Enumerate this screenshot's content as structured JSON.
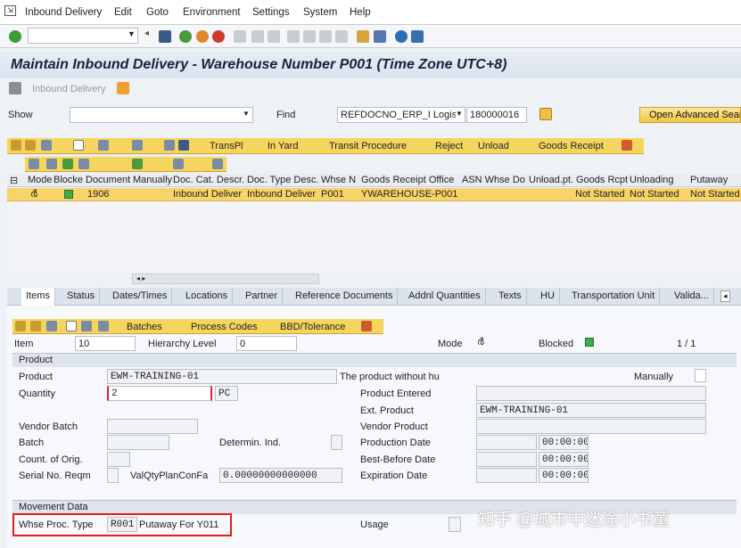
{
  "menu": {
    "items": [
      "Inbound Delivery",
      "Edit",
      "Goto",
      "Environment",
      "Settings",
      "System",
      "Help"
    ]
  },
  "title": "Maintain Inbound Delivery - Warehouse Number P001 (Time Zone UTC+8)",
  "app_toolbar": {
    "inbound_delivery": "Inbound Delivery"
  },
  "search": {
    "show_label": "Show",
    "find_label": "Find",
    "find_select": "REFDOCNO_ERP_I Logist",
    "find_value": "180000016",
    "open_advanced": "Open Advanced Sear"
  },
  "doc_toolbar": {
    "transpl": "TransPl",
    "in_yard": "In Yard",
    "transit": "Transit Procedure",
    "reject": "Reject",
    "unload": "Unload",
    "goods_receipt": "Goods Receipt"
  },
  "table": {
    "headers": [
      "Mode",
      "Blocke",
      "Document",
      "Manually",
      "Doc. Cat. Descr.",
      "Doc. Type Desc.",
      "Whse N",
      "Goods Receipt Office",
      "ASN Whse Do",
      "Unload.pt.",
      "Goods Rcpt",
      "Unloading",
      "Putaway"
    ],
    "row": {
      "document": "1906",
      "doc_cat": "Inbound Deliver",
      "doc_type": "Inbound Deliver",
      "whse": "P001",
      "gr_office": "YWAREHOUSE-P001",
      "goods_rcpt": "Not Started",
      "unloading": "Not Started",
      "putaway": "Not Started"
    },
    "blocked_color": "#3cb043"
  },
  "tabs": [
    "Items",
    "Status",
    "Dates/Times",
    "Locations",
    "Partner",
    "Reference Documents",
    "Addnl Quantities",
    "Texts",
    "HU",
    "Transportation Unit",
    "Valida..."
  ],
  "item_toolbar": {
    "batches": "Batches",
    "process_codes": "Process Codes",
    "bbd": "BBD/Tolerance"
  },
  "item": {
    "item_label": "Item",
    "item_value": "10",
    "hier_label": "Hierarchy Level",
    "hier_value": "0",
    "mode_label": "Mode",
    "blocked_label": "Blocked",
    "paging": "1 / 1"
  },
  "product": {
    "section": "Product",
    "product_label": "Product",
    "product_value": "EWM-TRAINING-01",
    "without_hu": "The product without hu",
    "manually": "Manually",
    "quantity_label": "Quantity",
    "quantity_value": "2",
    "unit": "PC",
    "product_entered": "Product Entered",
    "ext_product_label": "Ext. Product",
    "ext_product_value": "EWM-TRAINING-01",
    "vendor_batch": "Vendor Batch",
    "vendor_product": "Vendor Product",
    "batch": "Batch",
    "determin": "Determin. Ind.",
    "production_date": "Production Date",
    "production_time": "00:00:00",
    "count_orig": "Count. of Orig.",
    "best_before": "Best-Before Date",
    "best_before_time": "00:00:00",
    "serial": "Serial No. Reqm",
    "valqty": "ValQtyPlanConFa",
    "valqty_value": "0.00000000000000",
    "expiration": "Expiration Date",
    "expiration_time": "00:00:00"
  },
  "movement": {
    "section": "Movement Data",
    "whse_proc_label": "Whse Proc. Type",
    "whse_proc_code": "R001",
    "whse_proc_desc": "Putaway For Y011",
    "usage": "Usage"
  },
  "watermark": "知乎 @城市中迷途小书童"
}
